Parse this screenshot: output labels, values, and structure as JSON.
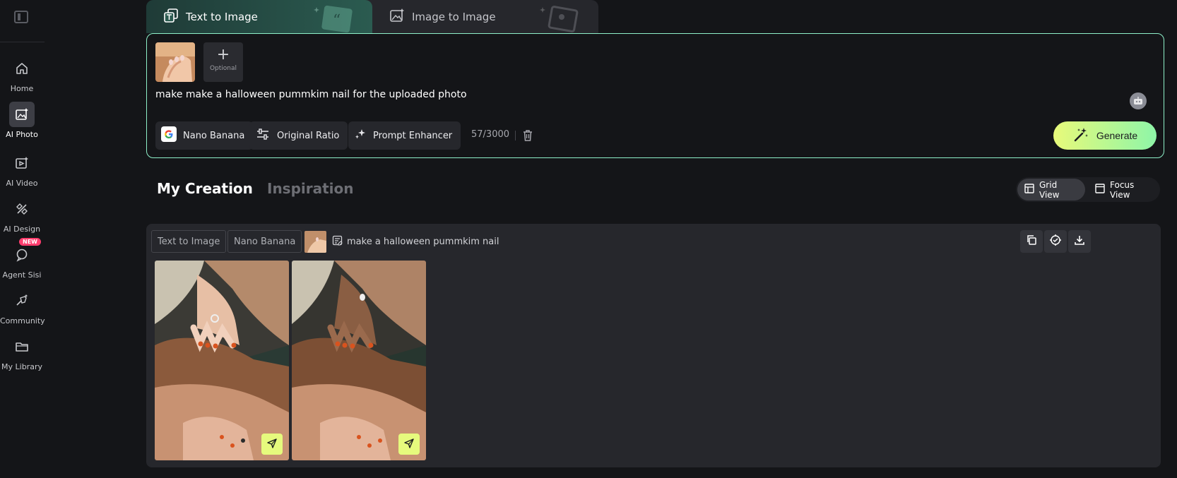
{
  "sidebar": {
    "toggle_icon": "sidebar-toggle-icon",
    "items": [
      {
        "label": "Home",
        "icon": "home-icon"
      },
      {
        "label": "AI Photo",
        "icon": "ai-photo-icon",
        "active": true
      },
      {
        "label": "AI Video",
        "icon": "ai-video-icon"
      },
      {
        "label": "AI Design",
        "icon": "ai-design-icon"
      },
      {
        "label": "Agent Sisi",
        "icon": "agent-icon",
        "badge": "NEW"
      },
      {
        "label": "Community",
        "icon": "community-icon"
      },
      {
        "label": "My Library",
        "icon": "folder-icon"
      }
    ]
  },
  "mode_tabs": {
    "text_to_image": "Text to Image",
    "image_to_image": "Image to Image",
    "active": "text_to_image"
  },
  "prompt": {
    "optional_label": "Optional",
    "text": "make make a halloween pummkim nail for the uploaded photo",
    "model": "Nano Banana",
    "ratio": "Original Ratio",
    "enhancer": "Prompt Enhancer",
    "char_count": "57/3000",
    "generate_label": "Generate"
  },
  "section_tabs": {
    "my_creation": "My Creation",
    "inspiration": "Inspiration"
  },
  "view_toggle": {
    "grid": "Grid View",
    "focus": "Focus View",
    "active": "grid"
  },
  "creation": {
    "tags": [
      "Text to Image",
      "Nano Banana"
    ],
    "prompt": "make a halloween pummkim nail",
    "results_count": 2
  },
  "colors": {
    "accent_border": "#8ef0c9",
    "generate_gradient_start": "#e8fa7a",
    "generate_gradient_end": "#8ef5a8",
    "badge_new": "#ff3d6e",
    "background": "#141518",
    "card": "#26272c"
  }
}
